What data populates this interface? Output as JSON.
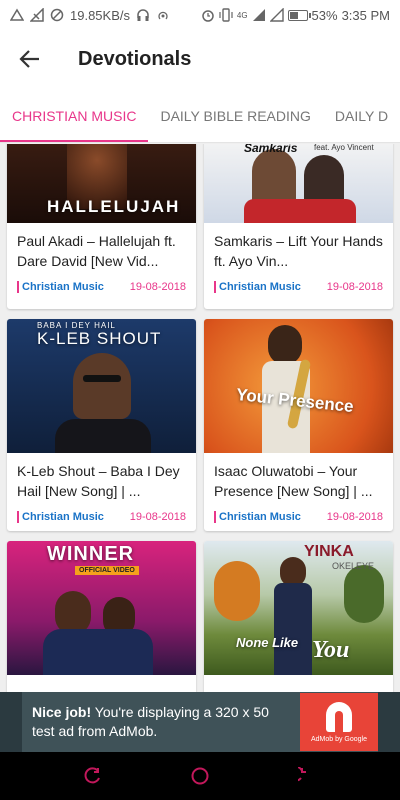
{
  "status_bar": {
    "speed": "19.85KB/s",
    "network": "4G",
    "battery": "53%",
    "battery_level": 0.53,
    "time": "3:35 PM"
  },
  "app_bar": {
    "title": "Devotionals",
    "back_icon": "arrow-left-icon"
  },
  "tabs": [
    {
      "label": "CHRISTIAN MUSIC",
      "active": true
    },
    {
      "label": "DAILY BIBLE READING",
      "active": false
    },
    {
      "label": "DAILY D",
      "active": false
    }
  ],
  "cards": [
    {
      "title": "Paul Akadi – Hallelujah ft. Dare David [New Vid...",
      "category": "Christian Music",
      "date": "19-08-2018",
      "thumb_text": "HALLELUJAH"
    },
    {
      "title": "Samkaris – Lift Your Hands ft. Ayo Vin...",
      "category": "Christian Music",
      "date": "19-08-2018",
      "thumb_text": "Samkaris",
      "thumb_subtext": "feat. Ayo Vincent"
    },
    {
      "title": "K-Leb Shout – Baba I Dey Hail [New Song] | ...",
      "category": "Christian Music",
      "date": "19-08-2018",
      "thumb_text": "K-LEB SHOUT",
      "thumb_subtext": "BABA I DEY HAIL"
    },
    {
      "title": "Isaac Oluwatobi – Your Presence [New Song] | ...",
      "category": "Christian Music",
      "date": "19-08-2018",
      "thumb_text": "Your Presence"
    },
    {
      "title": "",
      "category": "",
      "date": "",
      "thumb_text": "WINNER",
      "thumb_subtext": "OFFICIAL VIDEO"
    },
    {
      "title": "",
      "category": "",
      "date": "",
      "thumb_text": "YINKA",
      "thumb_subtext": "OKELEYE",
      "thumb_text2": "None Like",
      "thumb_text3": "You"
    }
  ],
  "ad": {
    "bold": "Nice job!",
    "text": " You're displaying a 320 x 50 test ad from AdMob.",
    "logo_label": "AdMob by Google"
  },
  "colors": {
    "accent": "#e8368a",
    "category": "#1a73c7",
    "ad_background": "#3f5258",
    "admob_red": "#e84438"
  }
}
